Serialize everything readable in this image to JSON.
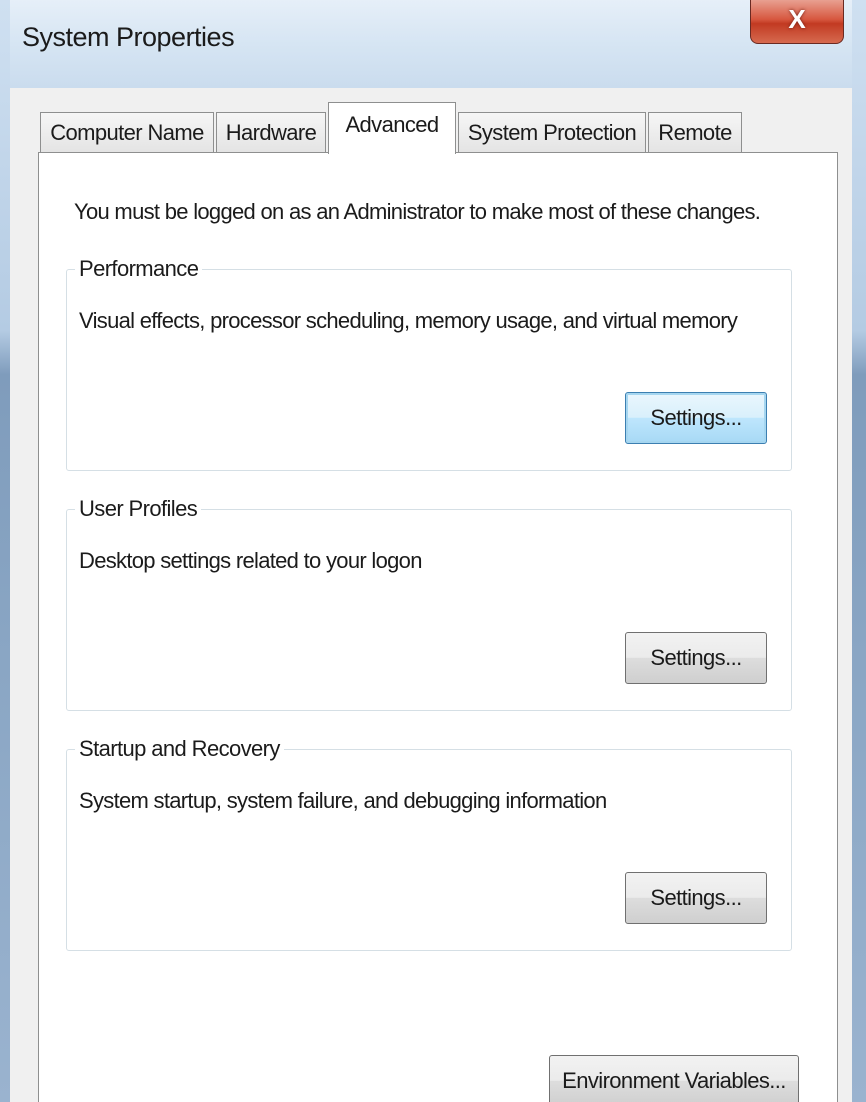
{
  "window": {
    "title": "System Properties",
    "close_label": "X"
  },
  "tabs": [
    {
      "label": "Computer Name",
      "active": false
    },
    {
      "label": "Hardware",
      "active": false
    },
    {
      "label": "Advanced",
      "active": true
    },
    {
      "label": "System Protection",
      "active": false
    },
    {
      "label": "Remote",
      "active": false
    }
  ],
  "advanced": {
    "admin_note": "You must be logged on as an Administrator to make most of these changes.",
    "performance": {
      "title": "Performance",
      "description": "Visual effects, processor scheduling, memory usage, and virtual memory",
      "button_label": "Settings..."
    },
    "user_profiles": {
      "title": "User Profiles",
      "description": "Desktop settings related to your logon",
      "button_label": "Settings..."
    },
    "startup_recovery": {
      "title": "Startup and Recovery",
      "description": "System startup, system failure, and debugging information",
      "button_label": "Settings..."
    },
    "env_button_label": "Environment Variables..."
  },
  "colors": {
    "focus_border": "#3c7fb1",
    "close_red": "#c23a22",
    "panel_bg": "#ffffff",
    "dialog_bg": "#f0f0f0"
  }
}
